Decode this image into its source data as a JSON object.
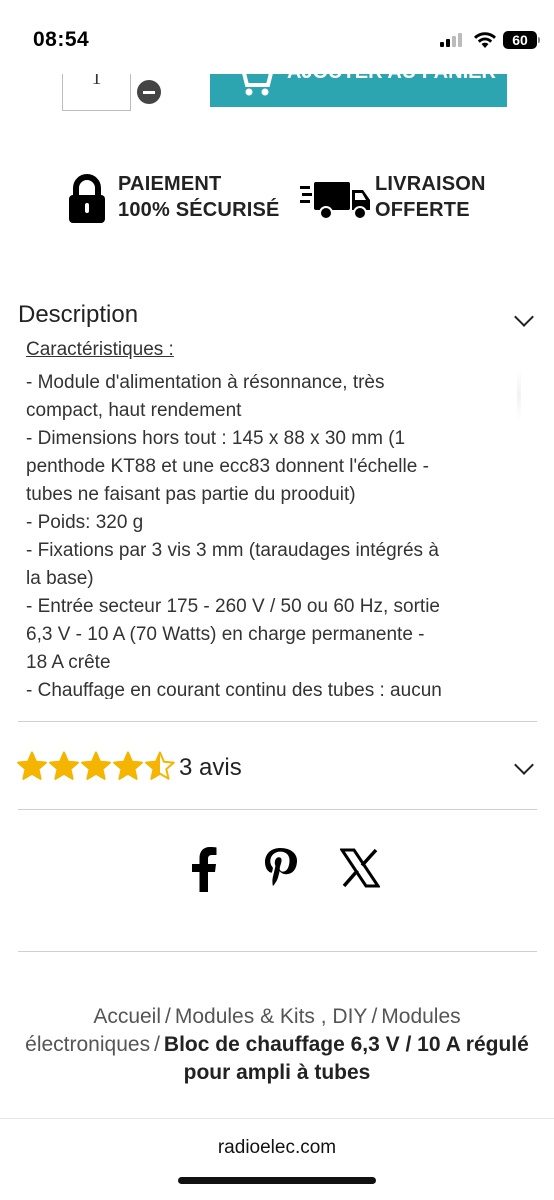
{
  "status_bar": {
    "time": "08:54",
    "battery": "60"
  },
  "product_actions": {
    "quantity": "1",
    "add_to_cart_label": "AJOUTER AU PANIER"
  },
  "reassurance": {
    "payment": {
      "line1": "PAIEMENT",
      "line2": "100% SÉCURISÉ",
      "icon": "lock-icon"
    },
    "delivery": {
      "line1": "LIVRAISON",
      "line2": "OFFERTE",
      "icon": "truck-icon"
    }
  },
  "description": {
    "title": "Description",
    "heading": "Caractéristiques :",
    "lines": [
      "- Module d'alimentation à résonnance, très",
      "compact, haut rendement",
      "- Dimensions hors tout : 145 x 88 x 30 mm (1",
      "penthode KT88 et une ecc83 donnent l'échelle -",
      "tubes ne faisant pas partie du prooduit)",
      "- Poids: 320 g",
      "- Fixations par 3 vis 3 mm (taraudages intégrés à",
      "la base)",
      "- Entrée secteur 175 - 260 V / 50 ou 60 Hz, sortie",
      "6,3 V - 10 A (70 Watts) en charge permanente -",
      "18 A crête",
      "- Chauffage en courant continu des tubes : aucun"
    ]
  },
  "reviews": {
    "rating": 4.5,
    "max": 5,
    "count_label": "3 avis",
    "star_color": "#f5b400"
  },
  "social": [
    "facebook-icon",
    "pinterest-icon",
    "x-icon"
  ],
  "breadcrumb": {
    "items": [
      "Accueil",
      "Modules & Kits , DIY",
      "Modules électroniques"
    ],
    "separator": "/",
    "current": "Bloc de chauffage 6,3 V / 10 A régulé pour ampli à tubes"
  },
  "browser": {
    "domain": "radioelec.com"
  },
  "colors": {
    "accent": "#2da5b1"
  }
}
